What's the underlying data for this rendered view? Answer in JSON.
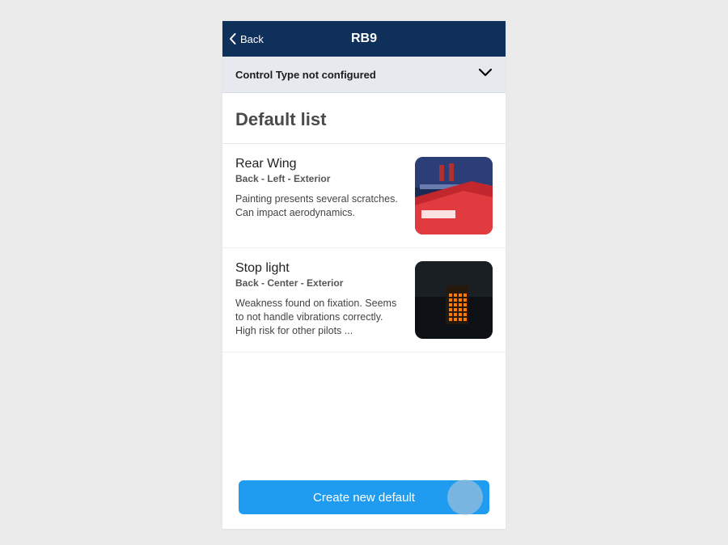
{
  "navbar": {
    "back_label": "Back",
    "title": "RB9"
  },
  "dropdown": {
    "label": "Control Type not configured"
  },
  "section": {
    "title": "Default list"
  },
  "items": [
    {
      "title": "Rear Wing",
      "subtitle": "Back - Left - Exterior",
      "description": "Painting presents several scratches. Can impact aerodynamics.",
      "thumb_kind": "rear-wing"
    },
    {
      "title": "Stop light",
      "subtitle": "Back - Center - Exterior",
      "description": "Weakness found on fixation. Seems to not handle vibrations correctly. High risk for other pilots ...",
      "thumb_kind": "stop-light"
    }
  ],
  "button": {
    "create_label": "Create new default"
  },
  "colors": {
    "navbar_bg": "#10305c",
    "accent": "#1f9cf0"
  }
}
